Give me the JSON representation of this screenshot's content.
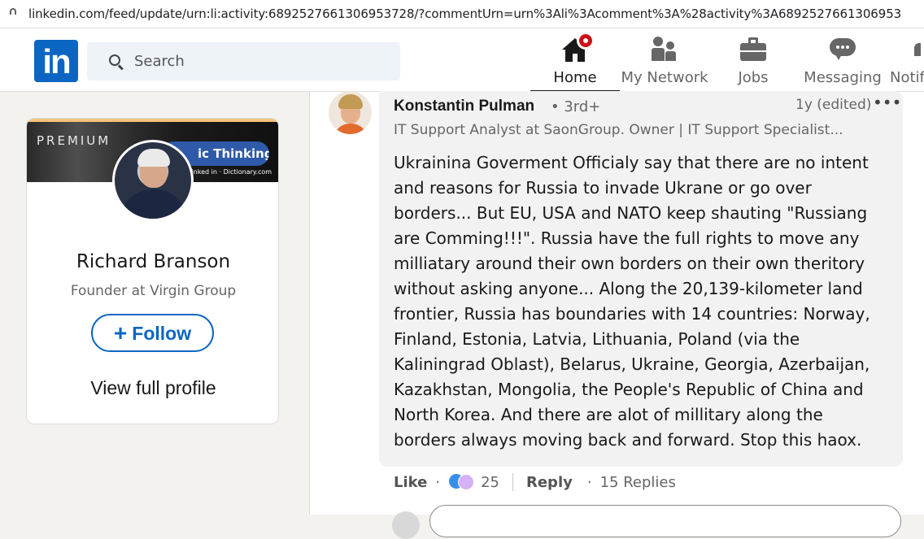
{
  "browser": {
    "url": "linkedin.com/feed/update/urn:li:activity:6892527661306953728/?commentUrn=urn%3Ali%3Acomment%3A%28activity%3A6892527661306953"
  },
  "nav": {
    "logo": "in",
    "search_placeholder": "Search",
    "items": [
      {
        "label": "Home",
        "icon": "home-icon",
        "active": true
      },
      {
        "label": "My Network",
        "icon": "network-icon"
      },
      {
        "label": "Jobs",
        "icon": "briefcase-icon"
      },
      {
        "label": "Messaging",
        "icon": "messaging-icon"
      },
      {
        "label": "Notif",
        "icon": "bell-icon"
      }
    ]
  },
  "profile_card": {
    "banner_premium": "PREMIUM",
    "banner_pill": "ic Thinking +",
    "banner_brand": "Linked in  ·  Dictionary.com",
    "name": "Richard Branson",
    "headline": "Founder at Virgin Group",
    "follow_label": "Follow",
    "view_profile": "View full profile"
  },
  "comment": {
    "author": "Konstantin Pulman",
    "degree": "• 3rd+",
    "time": "1y (edited)",
    "more": "•••",
    "subtitle": "IT Support Analyst at SaonGroup. Owner | IT Support Specialist...",
    "body": "Ukrainina Goverment Officialy say that there are no intent and reasons for Russia to invade Ukrane or go over borders... But EU, USA and NATO keep shauting \"Russiang are Comming!!!\". Russia have the full rights to move any milliatary around their own borders on their own theritory without asking anyone... Along the 20,139-kilometer land frontier, Russia has boundaries with 14 countries: Norway, Finland, Estonia, Latvia, Lithuania, Poland (via the Kaliningrad Oblast), Belarus, Ukraine, Georgia, Azerbaijan, Kazakhstan, Mongolia, the People's Republic of China and North Korea. And there are alot of millitary along the borders always moving back and forward. Stop this haox.",
    "like_label": "Like",
    "reaction_count": "25",
    "reply_label": "Reply",
    "replies": "15 Replies"
  },
  "colors": {
    "brand": "#0a66c2",
    "notification_badge": "#cc1016",
    "page_bg": "#f3f2ef",
    "bubble_bg": "#f2f2f2"
  }
}
